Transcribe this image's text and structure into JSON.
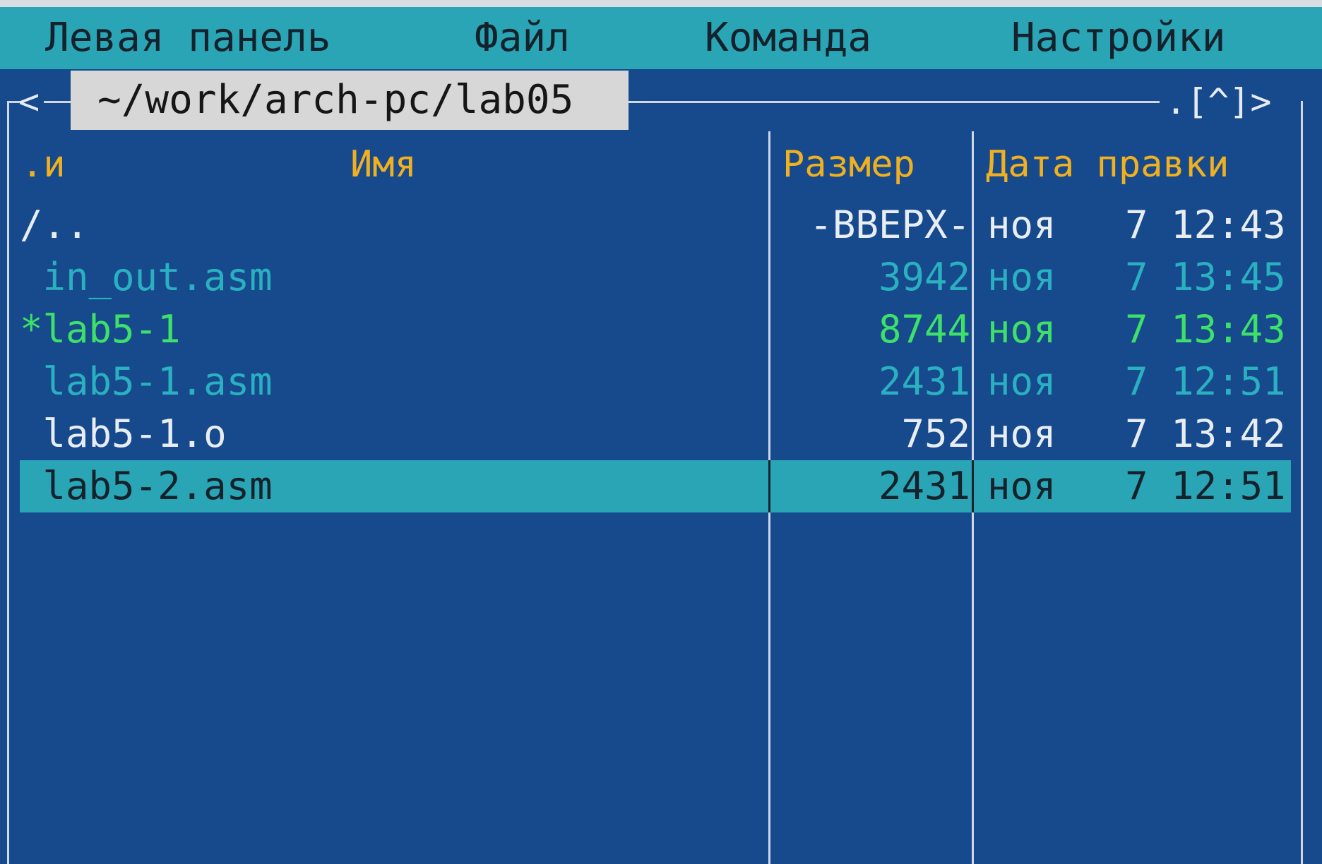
{
  "menu": {
    "items": [
      {
        "label": "Левая панель"
      },
      {
        "label": "Файл"
      },
      {
        "label": "Команда"
      },
      {
        "label": "Настройки"
      }
    ]
  },
  "panel": {
    "left_corner": "<",
    "right_corner": ".[^]>",
    "path": "~/work/arch-pc/lab05",
    "headers": {
      "sort": ".и",
      "name": "Имя",
      "size": "Размер",
      "date": "Дата правки"
    },
    "rows": [
      {
        "name": "/..",
        "size": "-ВВЕРХ-",
        "date": "ноя   7 12:43",
        "color": "#e8edf3"
      },
      {
        "name": " in_out.asm",
        "size": "3942",
        "date": "ноя   7 13:45",
        "color": "#2ab0c0"
      },
      {
        "name": "*lab5-1",
        "size": "8744",
        "date": "ноя   7 13:43",
        "color": "#3ee06a"
      },
      {
        "name": " lab5-1.asm",
        "size": "2431",
        "date": "ноя   7 12:51",
        "color": "#2ab0c0"
      },
      {
        "name": " lab5-1.o",
        "size": "752",
        "date": "ноя   7 13:42",
        "color": "#e8edf3"
      },
      {
        "name": " lab5-2.asm",
        "size": "2431",
        "date": "ноя   7 12:51",
        "color": "#15222c"
      }
    ]
  },
  "colors": {
    "background": "#164a8c",
    "menubar": "#2aa5b6",
    "header_text": "#f0b020",
    "selection": "#2aa5b6"
  }
}
